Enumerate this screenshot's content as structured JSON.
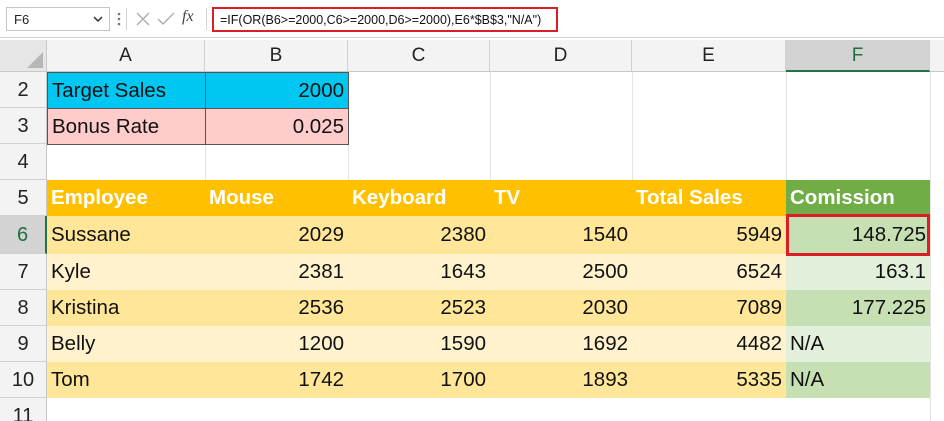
{
  "formula_bar": {
    "name_box": "F6",
    "fx_label": "fx",
    "formula": "=IF(OR(B6>=2000,C6>=2000,D6>=2000),E6*$B$3,\"N/A\")"
  },
  "columns": [
    "A",
    "B",
    "C",
    "D",
    "E",
    "F"
  ],
  "rows": [
    "2",
    "3",
    "4",
    "5",
    "6",
    "7",
    "8",
    "9",
    "10",
    "11"
  ],
  "params": {
    "target_label": "Target Sales",
    "target_value": "2000",
    "bonus_label": "Bonus Rate",
    "bonus_value": "0.025"
  },
  "table": {
    "headers": [
      "Employee",
      "Mouse",
      "Keyboard",
      "TV",
      "Total Sales",
      "Comission"
    ],
    "rows": [
      [
        "Sussane",
        "2029",
        "2380",
        "1540",
        "5949",
        "148.725"
      ],
      [
        "Kyle",
        "2381",
        "1643",
        "2500",
        "6524",
        "163.1"
      ],
      [
        "Kristina",
        "2536",
        "2523",
        "2030",
        "7089",
        "177.225"
      ],
      [
        "Belly",
        "1200",
        "1590",
        "1692",
        "4482",
        "N/A"
      ],
      [
        "Tom",
        "1742",
        "1700",
        "1893",
        "5335",
        "N/A"
      ]
    ]
  },
  "colors": {
    "highlight_border": "#d91e26",
    "header_orange": "#ffc000",
    "header_green": "#70ad47",
    "target_fill": "#00c6f2",
    "bonus_fill": "#ffcccc"
  }
}
